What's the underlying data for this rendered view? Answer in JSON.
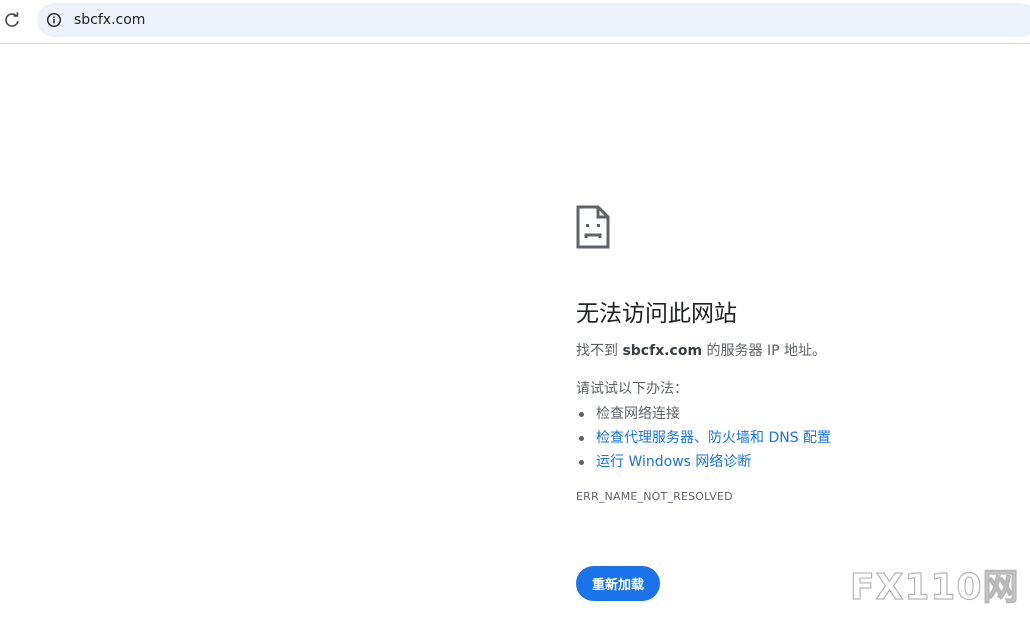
{
  "browser": {
    "url": "sbcfx.com",
    "icons": {
      "reload": "reload-icon",
      "site_info": "info-icon"
    }
  },
  "error_page": {
    "icon": "sad-document-icon",
    "title": "无法访问此网站",
    "summary_prefix": "找不到 ",
    "summary_host": "sbcfx.com",
    "summary_suffix": " 的服务器 IP 地址。",
    "try_heading": "请试试以下办法：",
    "suggestions": [
      {
        "label": "检查网络连接",
        "link": false
      },
      {
        "label": "检查代理服务器、防火墙和 DNS 配置",
        "link": true
      },
      {
        "label": "运行 Windows 网络诊断",
        "link": true
      }
    ],
    "error_code": "ERR_NAME_NOT_RESOLVED",
    "reload_label": "重新加载"
  },
  "watermark": {
    "text": "FX110网"
  },
  "colors": {
    "accent": "#1a73e8",
    "omnibox_bg": "#edf2fa",
    "secondary_text": "#5f6368"
  }
}
